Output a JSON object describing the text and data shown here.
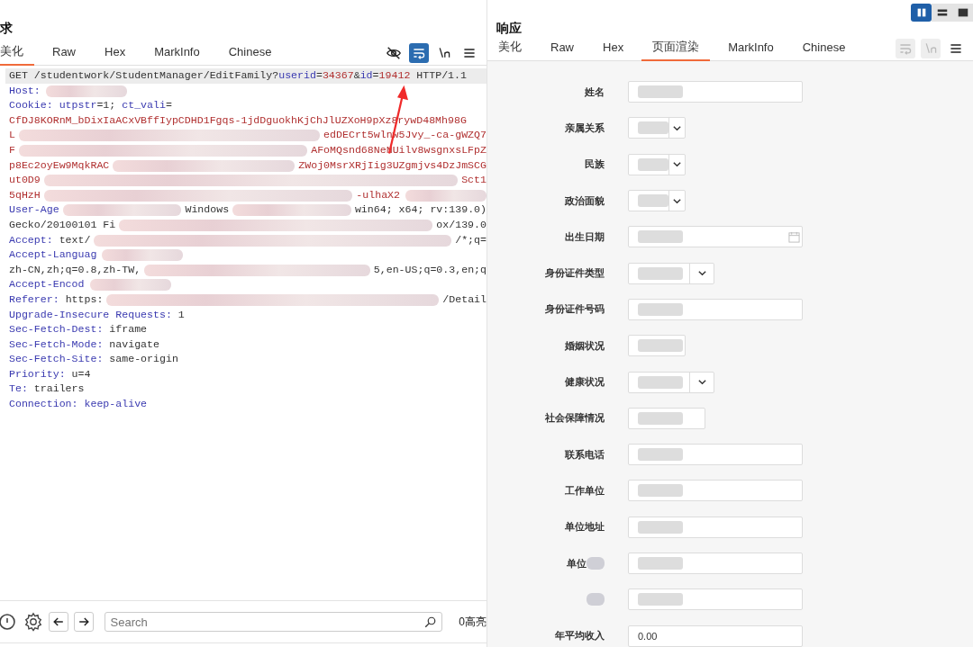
{
  "view_toggles": [
    {
      "kind": "split",
      "selected": true
    },
    {
      "kind": "rows",
      "selected": false
    },
    {
      "kind": "single",
      "selected": false
    }
  ],
  "request": {
    "title": "求",
    "tabs": [
      {
        "label": "美化",
        "selected": true
      },
      {
        "label": "Raw",
        "selected": false
      },
      {
        "label": "Hex",
        "selected": false
      },
      {
        "label": "MarkInfo",
        "selected": false
      },
      {
        "label": "Chinese",
        "selected": false
      }
    ],
    "tools": [
      {
        "kind": "hide",
        "on": false
      },
      {
        "kind": "wrap",
        "on": true
      },
      {
        "kind": "newline",
        "on": false
      },
      {
        "kind": "menu",
        "on": false
      }
    ],
    "lines": [
      {
        "highlighted": true,
        "parts": [
          {
            "kind": "text",
            "t": "GET /studentwork/StudentManager/EditFamily?"
          },
          {
            "kind": "param",
            "t": "userid"
          },
          {
            "kind": "text",
            "t": "="
          },
          {
            "kind": "value",
            "t": "34367"
          },
          {
            "kind": "text",
            "t": "&"
          },
          {
            "kind": "param",
            "t": "id"
          },
          {
            "kind": "text",
            "t": "="
          },
          {
            "kind": "value",
            "t": "19412"
          },
          {
            "kind": "text",
            "t": " HTTP/1.1"
          }
        ]
      },
      {
        "highlighted": false,
        "parts": [
          {
            "kind": "header",
            "t": "Host:"
          },
          {
            "kind": "redacted"
          }
        ]
      },
      {
        "highlighted": false,
        "parts": [
          {
            "kind": "header",
            "t": "Cookie: utpstr"
          },
          {
            "kind": "text",
            "t": "=1; "
          },
          {
            "kind": "header",
            "t": "ct_vali"
          },
          {
            "kind": "text",
            "t": "="
          }
        ]
      },
      {
        "highlighted": false,
        "parts": [
          {
            "kind": "value",
            "t": "CfDJ8KORnM_bDixIaACxVBffIypCDHD1Fgqs-1jdDguokhKjChJlUZXoH9pXz8rywD48Mh98G"
          }
        ]
      },
      {
        "highlighted": false,
        "parts": [
          {
            "kind": "value",
            "t": "L"
          },
          {
            "kind": "redacted"
          },
          {
            "kind": "value",
            "t": "edDECrt5wlnw5Jvy_-ca-gWZQ7"
          }
        ]
      },
      {
        "highlighted": false,
        "parts": [
          {
            "kind": "value",
            "t": "F"
          },
          {
            "kind": "redacted"
          },
          {
            "kind": "value",
            "t": "AFoMQsnd68NeNUilv8wsgnxsLFpZ"
          }
        ]
      },
      {
        "highlighted": false,
        "parts": [
          {
            "kind": "value",
            "t": "p8Ec2oyEw9MqkRAC"
          },
          {
            "kind": "redacted"
          },
          {
            "kind": "value",
            "t": "ZWoj0MsrXRjIig3UZgmjvs4DzJmSCG"
          }
        ]
      },
      {
        "highlighted": false,
        "parts": [
          {
            "kind": "value",
            "t": "ut0D9"
          },
          {
            "kind": "redacted"
          },
          {
            "kind": "value",
            "t": "Sct1"
          }
        ]
      },
      {
        "highlighted": false,
        "parts": [
          {
            "kind": "value",
            "t": "5qHzH"
          },
          {
            "kind": "redacted"
          },
          {
            "kind": "value",
            "t": "-ulhaX2"
          },
          {
            "kind": "redacted"
          }
        ]
      },
      {
        "highlighted": false,
        "parts": [
          {
            "kind": "header",
            "t": "User-Age"
          },
          {
            "kind": "redacted"
          },
          {
            "kind": "text",
            "t": "Windows"
          },
          {
            "kind": "redacted"
          },
          {
            "kind": "text",
            "t": "win64; x64; rv:139.0)"
          }
        ]
      },
      {
        "highlighted": false,
        "parts": [
          {
            "kind": "text",
            "t": "Gecko/20100101 Fi"
          },
          {
            "kind": "redacted"
          },
          {
            "kind": "text",
            "t": "ox/139.0"
          }
        ]
      },
      {
        "highlighted": false,
        "parts": [
          {
            "kind": "header",
            "t": "Accept:"
          },
          {
            "kind": "text",
            "t": " text/"
          },
          {
            "kind": "redacted"
          },
          {
            "kind": "text",
            "t": "/*;q="
          }
        ]
      },
      {
        "highlighted": false,
        "parts": [
          {
            "kind": "header",
            "t": "Accept-Languag"
          },
          {
            "kind": "redacted"
          }
        ]
      },
      {
        "highlighted": false,
        "parts": [
          {
            "kind": "text",
            "t": "zh-CN,zh;q=0.8,zh-TW,"
          },
          {
            "kind": "redacted"
          },
          {
            "kind": "text",
            "t": "5,en-US;q=0.3,en;q"
          }
        ]
      },
      {
        "highlighted": false,
        "parts": [
          {
            "kind": "header",
            "t": "Accept-Encod"
          },
          {
            "kind": "redacted"
          }
        ]
      },
      {
        "highlighted": false,
        "parts": [
          {
            "kind": "header",
            "t": "Referer:"
          },
          {
            "kind": "text",
            "t": " https:"
          },
          {
            "kind": "redacted"
          },
          {
            "kind": "text",
            "t": "/Detail"
          }
        ]
      },
      {
        "highlighted": false,
        "parts": [
          {
            "kind": "header",
            "t": "Upgrade-Insecure Requests:"
          },
          {
            "kind": "text",
            "t": " 1"
          }
        ]
      },
      {
        "highlighted": false,
        "parts": [
          {
            "kind": "header",
            "t": "Sec-Fetch-Dest:"
          },
          {
            "kind": "text",
            "t": " iframe"
          }
        ]
      },
      {
        "highlighted": false,
        "parts": [
          {
            "kind": "header",
            "t": "Sec-Fetch-Mode:"
          },
          {
            "kind": "text",
            "t": " navigate"
          }
        ]
      },
      {
        "highlighted": false,
        "parts": [
          {
            "kind": "header",
            "t": "Sec-Fetch-Site:"
          },
          {
            "kind": "text",
            "t": " same-origin"
          }
        ]
      },
      {
        "highlighted": false,
        "parts": [
          {
            "kind": "header",
            "t": "Priority:"
          },
          {
            "kind": "text",
            "t": " u=4"
          }
        ]
      },
      {
        "highlighted": false,
        "parts": [
          {
            "kind": "header",
            "t": "Te:"
          },
          {
            "kind": "text",
            "t": " trailers"
          }
        ]
      },
      {
        "highlighted": false,
        "parts": [
          {
            "kind": "header",
            "t": "Connection: keep-alive"
          }
        ]
      }
    ],
    "search": {
      "placeholder": "Search"
    },
    "highlight_count": "0高亮"
  },
  "response": {
    "title": "响应",
    "tabs": [
      {
        "label": "美化",
        "selected": false
      },
      {
        "label": "Raw",
        "selected": false
      },
      {
        "label": "Hex",
        "selected": false
      },
      {
        "label": "页面渲染",
        "selected": true
      },
      {
        "label": "MarkInfo",
        "selected": false
      },
      {
        "label": "Chinese",
        "selected": false
      }
    ],
    "tools": [
      {
        "kind": "wrap",
        "disabled": true
      },
      {
        "kind": "newline",
        "disabled": true
      },
      {
        "kind": "menu",
        "disabled": false
      }
    ],
    "form": [
      {
        "label": "姓名",
        "kind": "text"
      },
      {
        "label": "亲属关系",
        "kind": "select"
      },
      {
        "label": "民族",
        "kind": "select"
      },
      {
        "label": "政治面貌",
        "kind": "select"
      },
      {
        "label": "出生日期",
        "kind": "date"
      },
      {
        "label": "身份证件类型",
        "kind": "select-wide"
      },
      {
        "label": "身份证件号码",
        "kind": "text"
      },
      {
        "label": "婚姻状况",
        "kind": "short"
      },
      {
        "label": "健康状况",
        "kind": "select-wide"
      },
      {
        "label": "社会保障情况",
        "kind": "short-wide"
      },
      {
        "label": "联系电话",
        "kind": "text"
      },
      {
        "label": "工作单位",
        "kind": "text"
      },
      {
        "label": "单位地址",
        "kind": "text"
      },
      {
        "label": "单位",
        "kind": "text"
      },
      {
        "kind": "text"
      },
      {
        "label": "年平均收入",
        "kind": "text",
        "value": "0.00"
      }
    ]
  }
}
